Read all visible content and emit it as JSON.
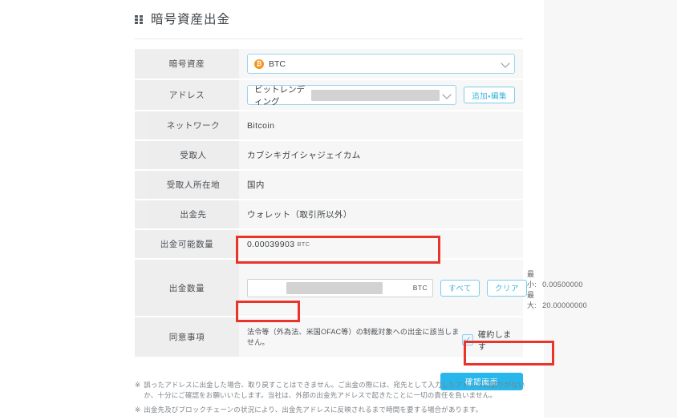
{
  "header": {
    "title": "暗号資産出金",
    "icon": "grid-icon"
  },
  "form": {
    "asset": {
      "label": "暗号資産",
      "value": "BTC",
      "badge": "₿",
      "chevron": "chevron-down-icon"
    },
    "address": {
      "label": "アドレス",
      "value": "ビットレンディング",
      "edit_button": "追加・編集",
      "chevron": "chevron-down-icon"
    },
    "network": {
      "label": "ネットワーク",
      "value": "Bitcoin"
    },
    "recipient": {
      "label": "受取人",
      "value": "カブシキガイシャジェイカム"
    },
    "recipient_location": {
      "label": "受取人所在地",
      "value": "国内"
    },
    "destination": {
      "label": "出金先",
      "value": "ウォレット（取引所以外）"
    },
    "available": {
      "label": "出金可能数量",
      "value": "0.00039903",
      "unit": "BTC"
    },
    "amount": {
      "label": "出金数量",
      "unit": "BTC",
      "all_button": "すべて",
      "clear_button": "クリア",
      "min_label": "最小:",
      "min_value": "0.00500000",
      "max_label": "最大:",
      "max_value": "20.00000000"
    },
    "agreement": {
      "label": "同意事項",
      "text": "法令等（外為法、米国OFAC等）の制裁対象への出金に該当しません。",
      "checkbox_label": "確約します",
      "checked": true
    }
  },
  "submit": {
    "label": "確認画面"
  },
  "notes": [
    {
      "mark": "※",
      "text": "誤ったアドレスに出金した場合、取り戻すことはできません。ご出金の際には、宛先として入力したアドレスに誤りがないか、十分にご確認をお願いいたします。当社は、外部の出金先アドレスで起きたことに一切の責任を負いません。"
    },
    {
      "mark": "※",
      "text": "出金先及びブロックチェーンの状況により、出金先アドレスに反映されるまで時間を要する場合があります。"
    }
  ],
  "colors": {
    "accent": "#29b6ea",
    "annotation": "#e8342a",
    "btc": "#f7941d",
    "label_bg": "#eeeeee"
  }
}
